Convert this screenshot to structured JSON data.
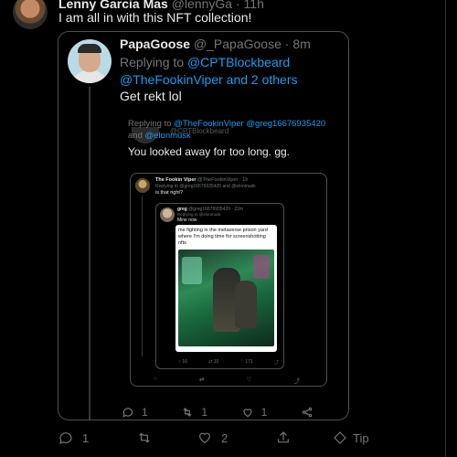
{
  "top_tweet": {
    "name": "Lenny Garcia Mas",
    "handle": "@lennyGa",
    "time": "11h",
    "text": "I am all in with this NFT collection!",
    "actions": {
      "reply_count": "1",
      "retweet_count": "",
      "like_count": "2",
      "tip_label": "Tip"
    }
  },
  "quote1": {
    "name": "PapaGoose",
    "handle": "@_PapaGoose",
    "time": "8m",
    "replying_prefix": "Replying to",
    "replying_1": "@CPTBlockbeard",
    "replying_2": "@TheFookinViper and 2 others",
    "text": "Get rekt lol"
  },
  "quote2": {
    "cut_header": "@CPTBlockbeard",
    "replying_prefix": "Replying to",
    "replying_1": "@TheFookinViper",
    "replying_2": "@greg16676935420",
    "replying_and": "and",
    "replying_3": "@elonmusk",
    "text": "You looked away for too long. gg.",
    "actions": {
      "reply": "1",
      "retweet": "1",
      "like": "1"
    }
  },
  "quote3": {
    "name": "The Fookin Viper",
    "handle": "@TheFookinViper",
    "time": "1h",
    "replying": "Replying to @greg16676935420 and @elonmusk",
    "text": "is that right?",
    "actions": {
      "reply": "",
      "retweet": "",
      "like": "",
      "share": ""
    }
  },
  "quote4": {
    "name": "greg",
    "handle": "@greg16676935420",
    "time": "22m",
    "replying": "Replying to @elonmusk",
    "text": "Mine now",
    "meme_caption": "me fighting in the metaverse prison yard where I'm doing time for screenshotting nfts",
    "actions": {
      "reply": "16",
      "retweet": "10",
      "like": "171"
    }
  }
}
